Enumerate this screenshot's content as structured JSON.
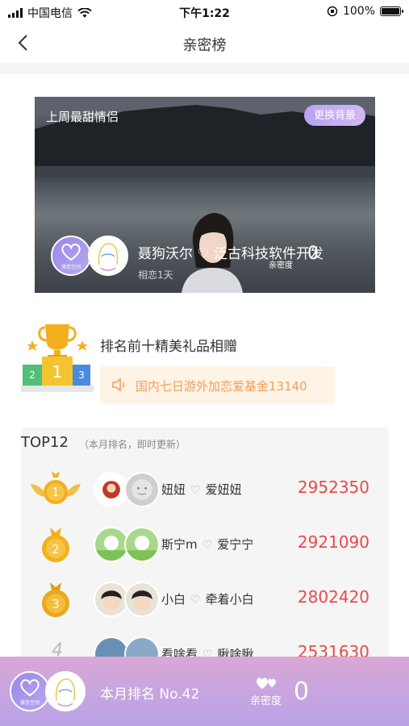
{
  "status_bar": {
    "carrier": "中国电信",
    "time": "下午1:22",
    "battery": "100%"
  },
  "nav": {
    "title": "亲密榜"
  },
  "banner": {
    "title": "上周最甜情侣",
    "change_bg": "更换背景",
    "names": "聂狗沃尔 ♡ 泛古科技软件开发",
    "days": "相恋1天",
    "intimacy_label": "亲密度",
    "intimacy_value": "0",
    "avatar_tag": "律恋空间"
  },
  "prize": {
    "title": "排名前十精美礼品相赠",
    "marquee": "国内七日游外加恋爱基金13140",
    "podium": [
      "2",
      "1",
      "3"
    ]
  },
  "ranking": {
    "title": "TOP12",
    "subtitle": "（本月排名，即时更新）",
    "rows": [
      {
        "rank": "1",
        "name_a": "妞妞",
        "name_b": "爱妞妞",
        "score": "2952350"
      },
      {
        "rank": "2",
        "name_a": "斯宁m",
        "name_b": "爱宁宁",
        "score": "2921090"
      },
      {
        "rank": "3",
        "name_a": "小白",
        "name_b": "牵着小白",
        "score": "2802420"
      },
      {
        "rank": "4",
        "name_a": "看啥看",
        "name_b": "瞅啥瞅",
        "score": "2531630"
      }
    ]
  },
  "bottom": {
    "my_rank": "本月排名 No.42",
    "intimacy_label": "亲密度",
    "intimacy_value": "0",
    "avatar_tag": "律恋空间"
  }
}
